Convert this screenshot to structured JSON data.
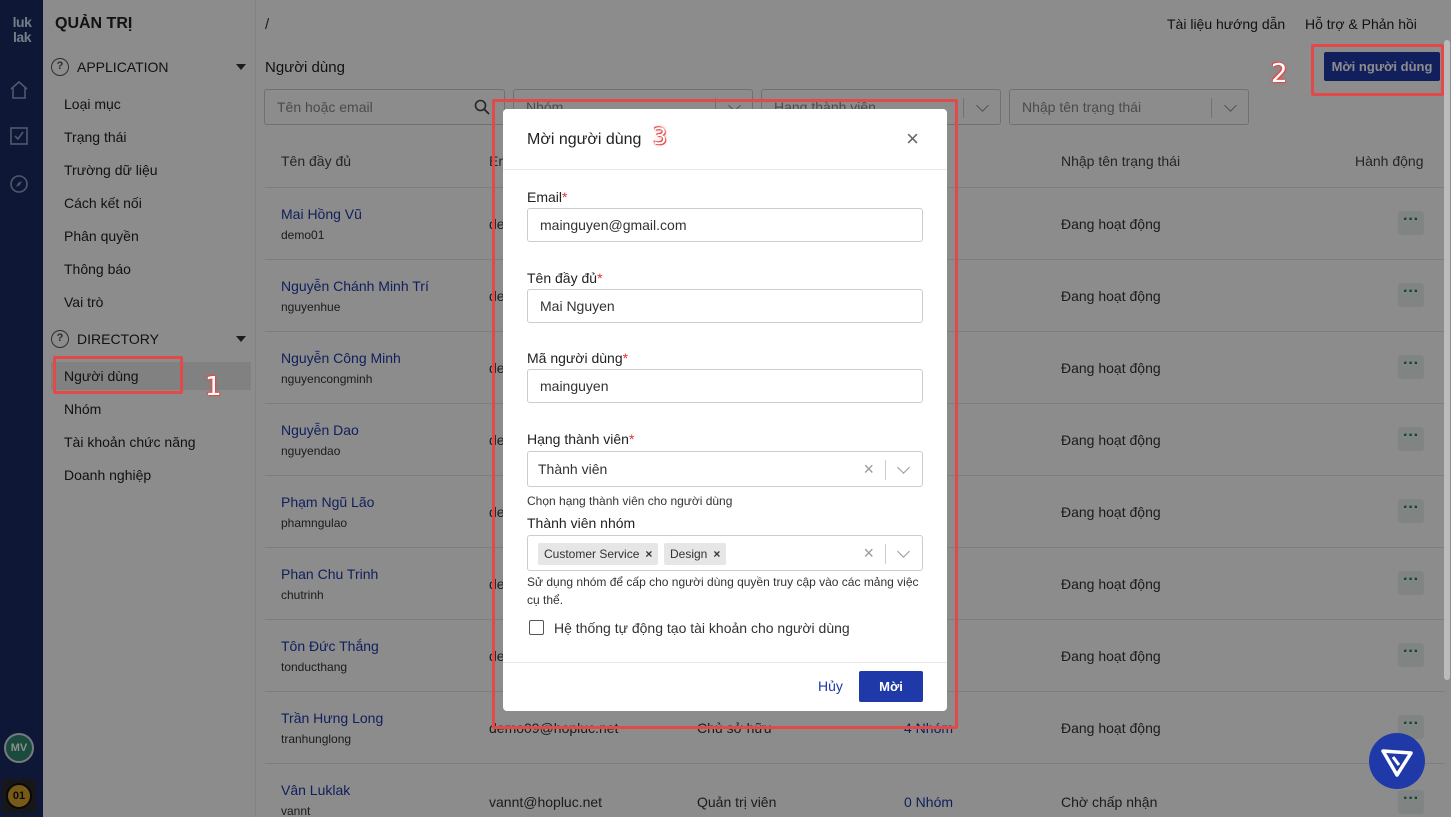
{
  "app": {
    "logo_text": "luk lak",
    "title": "QUẢN TRỊ"
  },
  "rail": {
    "avatar_initials": "MV",
    "badge": "01"
  },
  "sidebar": {
    "sections": [
      {
        "label": "APPLICATION",
        "items": [
          "Loại mục",
          "Trạng thái",
          "Trường dữ liệu",
          "Cách kết nối",
          "Phân quyền",
          "Thông báo",
          "Vai trò"
        ]
      },
      {
        "label": "DIRECTORY",
        "items": [
          "Người dùng",
          "Nhóm",
          "Tài khoản chức năng",
          "Doanh nghiệp"
        ]
      }
    ]
  },
  "header": {
    "breadcrumb": "/",
    "links": [
      "Tài liệu hướng dẫn",
      "Hỗ trợ & Phản hồi"
    ],
    "page_title": "Người dùng",
    "invite_button": "Mời người dùng"
  },
  "filters": {
    "search_placeholder": "Tên hoặc email",
    "group_placeholder": "Nhóm",
    "tier_placeholder": "Hạng thành viên",
    "status_placeholder": "Nhập tên trạng thái"
  },
  "table": {
    "columns": [
      "Tên đầy đủ",
      "Em",
      "Nhập tên trạng thái",
      "Hành động"
    ],
    "rows": [
      {
        "name": "Mai Hồng Vũ",
        "uid": "demo01",
        "email": "de",
        "role": "",
        "groups": "m",
        "status": "Đang hoạt động"
      },
      {
        "name": "Nguyễn Chánh Minh Trí",
        "uid": "nguyenhue",
        "email": "de",
        "role": "",
        "groups": "m",
        "status": "Đang hoạt động"
      },
      {
        "name": "Nguyễn Công Minh",
        "uid": "nguyencongminh",
        "email": "de",
        "role": "",
        "groups": "m",
        "status": "Đang hoạt động"
      },
      {
        "name": "Nguyễn Dao",
        "uid": "nguyendao",
        "email": "de",
        "role": "",
        "groups": "m",
        "status": "Đang hoạt động"
      },
      {
        "name": "Phạm Ngũ Lão",
        "uid": "phamngulao",
        "email": "de",
        "role": "",
        "groups": "m",
        "status": "Đang hoạt động"
      },
      {
        "name": "Phan Chu Trinh",
        "uid": "chutrinh",
        "email": "de",
        "role": "",
        "groups": "m",
        "status": "Đang hoạt động"
      },
      {
        "name": "Tôn Đức Thắng",
        "uid": "tonducthang",
        "email": "de",
        "role": "",
        "groups": "m",
        "status": "Đang hoạt động"
      },
      {
        "name": "Trần Hưng Long",
        "uid": "tranhunglong",
        "email": "demo09@hopluc.net",
        "role": "Chủ sở hữu",
        "groups": "4 Nhóm",
        "status": "Đang hoạt động"
      },
      {
        "name": "Vân Luklak",
        "uid": "vannt",
        "email": "vannt@hopluc.net",
        "role": "Quản trị viên",
        "groups": "0 Nhóm",
        "status": "Chờ chấp nhận"
      }
    ],
    "more_label": "···"
  },
  "annotations": [
    "1",
    "2",
    "3"
  ],
  "modal": {
    "title": "Mời người dùng",
    "close": "×",
    "email_label": "Email",
    "email_value": "mainguyen@gmail.com",
    "fullname_label": "Tên đầy đủ",
    "fullname_value": "Mai Nguyen",
    "userid_label": "Mã người dùng",
    "userid_value": "mainguyen",
    "tier_label": "Hạng thành viên",
    "tier_value": "Thành viên",
    "tier_hint": "Chọn hạng thành viên cho người dùng",
    "groups_label": "Thành viên nhóm",
    "groups_tags": [
      "Customer Service",
      "Design"
    ],
    "groups_hint": "Sử dụng nhóm để cấp cho người dùng quyền truy cập vào các mảng việc cụ thể.",
    "auto_account_label": "Hệ thống tự động tạo tài khoản cho người dùng",
    "required_mark": "*",
    "clear": "×",
    "cancel": "Hủy",
    "submit": "Mời"
  },
  "colors": {
    "rail": "#1b2a63",
    "accent": "#1f3aa8",
    "annotation": "#e24a4a"
  }
}
